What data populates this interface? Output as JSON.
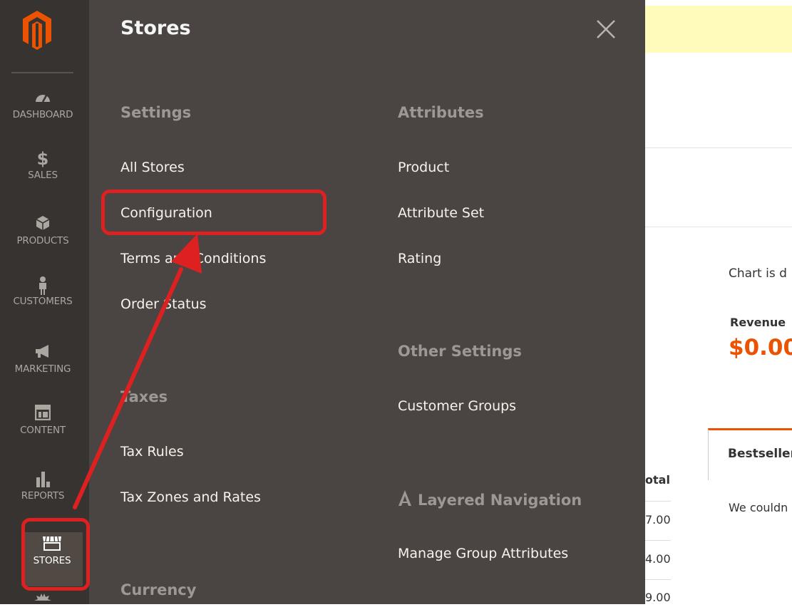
{
  "sidebar": {
    "items": [
      {
        "label": "DASHBOARD",
        "icon": "dashboard-icon"
      },
      {
        "label": "SALES",
        "icon": "dollar-icon"
      },
      {
        "label": "PRODUCTS",
        "icon": "cube-icon"
      },
      {
        "label": "CUSTOMERS",
        "icon": "person-icon"
      },
      {
        "label": "MARKETING",
        "icon": "megaphone-icon"
      },
      {
        "label": "CONTENT",
        "icon": "layout-icon"
      },
      {
        "label": "REPORTS",
        "icon": "bar-chart-icon"
      },
      {
        "label": "STORES",
        "icon": "storefront-icon"
      }
    ]
  },
  "flyout": {
    "title": "Stores",
    "settings": {
      "heading": "Settings",
      "links": [
        "All Stores",
        "Configuration",
        "Terms and Conditions",
        "Order Status"
      ]
    },
    "taxes": {
      "heading": "Taxes",
      "links": [
        "Tax Rules",
        "Tax Zones and Rates"
      ]
    },
    "currency": {
      "heading": "Currency"
    },
    "attributes": {
      "heading": "Attributes",
      "links": [
        "Product",
        "Attribute Set",
        "Rating"
      ]
    },
    "other_settings": {
      "heading": "Other Settings",
      "links": [
        "Customer Groups"
      ]
    },
    "layered_navigation": {
      "heading": "Layered Navigation",
      "icon": "letter-a-icon",
      "links": [
        "Manage Group Attributes"
      ]
    }
  },
  "background": {
    "chart_text": "Chart is d",
    "revenue_label": "Revenue",
    "revenue_value": "$0.00",
    "tab_label": "Bestseller",
    "empty_text": "We couldn",
    "table_header": "otal",
    "table_values": [
      "7.00",
      "4.00",
      "9.00"
    ]
  },
  "colors": {
    "sidebar_bg": "#373330",
    "flyout_bg": "#4a4542",
    "brand_orange": "#eb5202",
    "annotation_red": "#dd2020",
    "notice_yellow": "#fffbbb"
  }
}
